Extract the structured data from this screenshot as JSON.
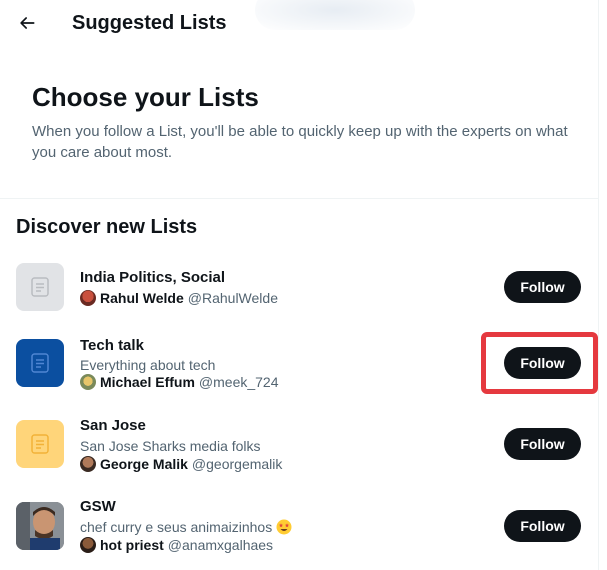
{
  "header": {
    "title": "Suggested Lists",
    "back_icon": "arrow-left-icon"
  },
  "intro": {
    "title": "Choose your Lists",
    "description": "When you follow a List, you'll be able to quickly keep up with the experts on what you care about most."
  },
  "section": {
    "title": "Discover new Lists"
  },
  "lists": [
    {
      "name": "India Politics, Social",
      "description": "",
      "owner_name": "Rahul Welde",
      "owner_handle": "@RahulWelde",
      "follow_label": "Follow",
      "thumb_color": "#e1e3e6",
      "icon": "list-document-icon"
    },
    {
      "name": "Tech talk",
      "description": "Everything about tech",
      "owner_name": "Michael Effum",
      "owner_handle": "@meek_724",
      "follow_label": "Follow",
      "thumb_color": "#0b4fa0",
      "icon": "list-document-icon",
      "highlighted": true
    },
    {
      "name": "San Jose",
      "description": "San Jose Sharks media folks",
      "owner_name": "George Malik",
      "owner_handle": "@georgemalik",
      "follow_label": "Follow",
      "thumb_color": "#ffd57a",
      "icon": "list-document-icon"
    },
    {
      "name": "GSW",
      "description": "chef curry e seus animaizinhos",
      "description_emoji": "star-struck-emoji-icon",
      "owner_name": "hot priest",
      "owner_handle": "@anamxgalhaes",
      "follow_label": "Follow",
      "thumb_color": "#6b7075",
      "icon": "photo-thumbnail"
    }
  ],
  "colors": {
    "text_primary": "#0f1419",
    "text_secondary": "#536471",
    "button_bg": "#0f1419",
    "highlight": "#e5393f"
  }
}
